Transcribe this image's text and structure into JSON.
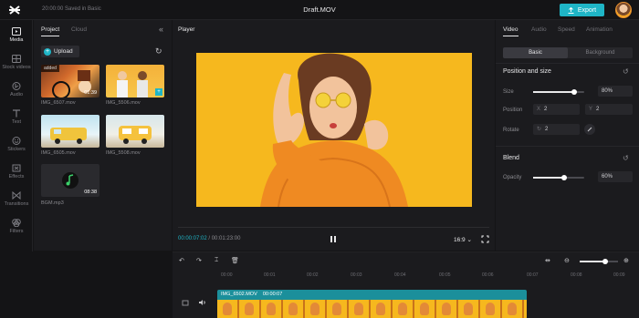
{
  "topbar": {
    "saved_text": "20:00:00 Saved in Basic",
    "title": "Draft.MOV",
    "export_label": "Export"
  },
  "nav": [
    {
      "label": "Media",
      "icon": "media-icon",
      "active": true
    },
    {
      "label": "Stock videos",
      "icon": "stock-videos-icon",
      "active": false
    },
    {
      "label": "Audio",
      "icon": "audio-icon",
      "active": false
    },
    {
      "label": "Text",
      "icon": "text-icon",
      "active": false
    },
    {
      "label": "Stickers",
      "icon": "stickers-icon",
      "active": false
    },
    {
      "label": "Effects",
      "icon": "effects-icon",
      "active": false
    },
    {
      "label": "Transitions",
      "icon": "transitions-icon",
      "active": false
    },
    {
      "label": "Filters",
      "icon": "filters-icon",
      "active": false
    }
  ],
  "media": {
    "tabs": [
      "Project",
      "Cloud"
    ],
    "upload_label": "Upload",
    "items": [
      {
        "name": "IMG_6507.mov",
        "duration": "01:39",
        "added": "added"
      },
      {
        "name": "IMG_5506.mov",
        "duration": "",
        "added": ""
      },
      {
        "name": "IMG_6505.mov",
        "duration": "",
        "added": ""
      },
      {
        "name": "IMG_5508.mov",
        "duration": "",
        "added": ""
      },
      {
        "name": "BGM.mp3",
        "duration": "08:38",
        "added": ""
      }
    ]
  },
  "player": {
    "title": "Player",
    "current_time": "00:00:07:02",
    "total_time": "00:01:23:00",
    "ratio": "16:9"
  },
  "props": {
    "tabs": [
      "Video",
      "Audio",
      "Speed",
      "Animation"
    ],
    "segments": [
      "Basic",
      "Background"
    ],
    "position_title": "Position and size",
    "size_label": "Size",
    "size_value": "80%",
    "size_level": 0.8,
    "position_label": "Position",
    "pos_x_axis": "X",
    "pos_x": "2",
    "pos_y_axis": "Y",
    "pos_y": "2",
    "rotate_label": "Rotate",
    "rotate_value": "2",
    "blend_title": "Blend",
    "opacity_label": "Opacity",
    "opacity_value": "60%",
    "opacity_level": 0.6
  },
  "timeline": {
    "ticks": [
      "00:00",
      "00:01",
      "00:02",
      "00:03",
      "00:04",
      "00:05",
      "00:06",
      "00:07",
      "00:08",
      "00:09"
    ],
    "clip_name": "IMG_6502.MOV",
    "clip_time": "00:00:07"
  },
  "colors": {
    "accent": "#1fb5c6",
    "video_bg": "#f6b81e"
  }
}
